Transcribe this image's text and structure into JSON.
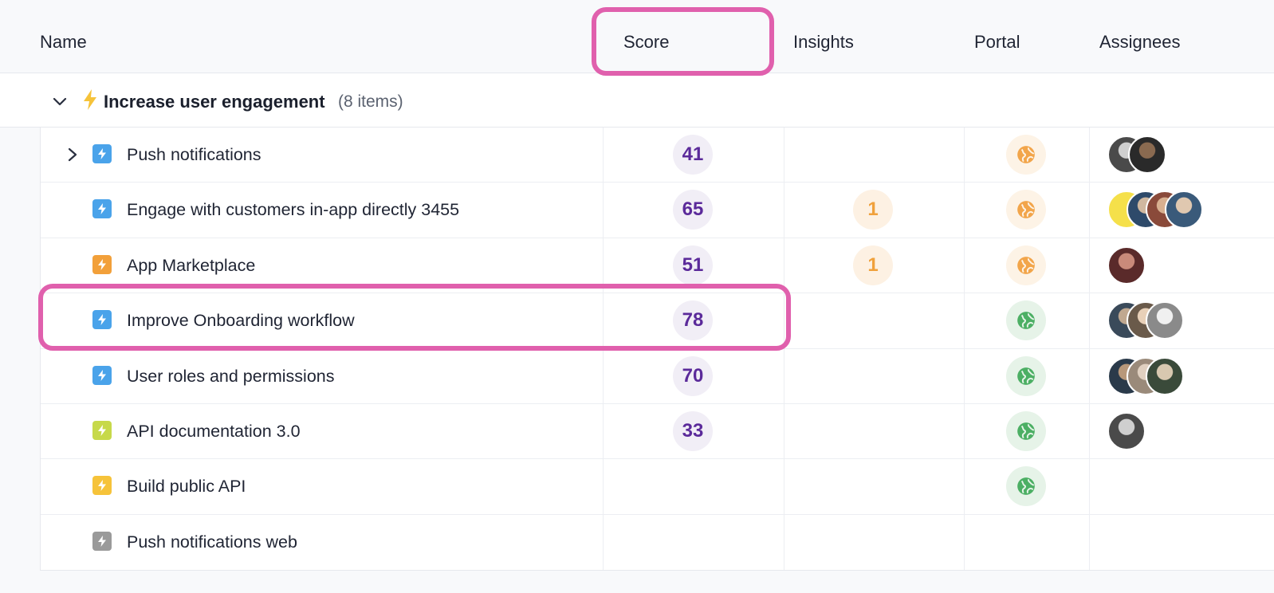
{
  "columns": {
    "name": "Name",
    "score": "Score",
    "insights": "Insights",
    "portal": "Portal",
    "assignees": "Assignees"
  },
  "group": {
    "title": "Increase user engagement",
    "count": "(8 items)"
  },
  "colors": {
    "accent_highlight": "#e060ad",
    "score_text": "#5b2a9a",
    "insight_text": "#f0a13c",
    "portal_orange": "#f2a54a",
    "portal_green": "#4caf64"
  },
  "rows": [
    {
      "name": "Push notifications",
      "score": "41",
      "insights": "",
      "portal": "orange",
      "icon_color": "#4aa3ea",
      "has_children": true,
      "assignees": 2
    },
    {
      "name": "Engage with customers in-app directly 3455",
      "score": "65",
      "insights": "1",
      "portal": "orange",
      "icon_color": "#4aa3ea",
      "has_children": false,
      "assignees": 4
    },
    {
      "name": "App Marketplace",
      "score": "51",
      "insights": "1",
      "portal": "orange",
      "icon_color": "#f2a03a",
      "has_children": false,
      "assignees": 1
    },
    {
      "name": "Improve Onboarding workflow",
      "score": "78",
      "insights": "",
      "portal": "green",
      "icon_color": "#4aa3ea",
      "has_children": false,
      "assignees": 3
    },
    {
      "name": "User roles and permissions",
      "score": "70",
      "insights": "",
      "portal": "green",
      "icon_color": "#4aa3ea",
      "has_children": false,
      "assignees": 3
    },
    {
      "name": "API documentation 3.0",
      "score": "33",
      "insights": "",
      "portal": "green",
      "icon_color": "#c7d94a",
      "has_children": false,
      "assignees": 1
    },
    {
      "name": "Build public API",
      "score": "",
      "insights": "",
      "portal": "green",
      "icon_color": "#f6c33a",
      "has_children": false,
      "assignees": 0
    },
    {
      "name": "Push notifications web",
      "score": "",
      "insights": "",
      "portal": "",
      "icon_color": "#9a9a9a",
      "has_children": false,
      "assignees": 0
    }
  ]
}
